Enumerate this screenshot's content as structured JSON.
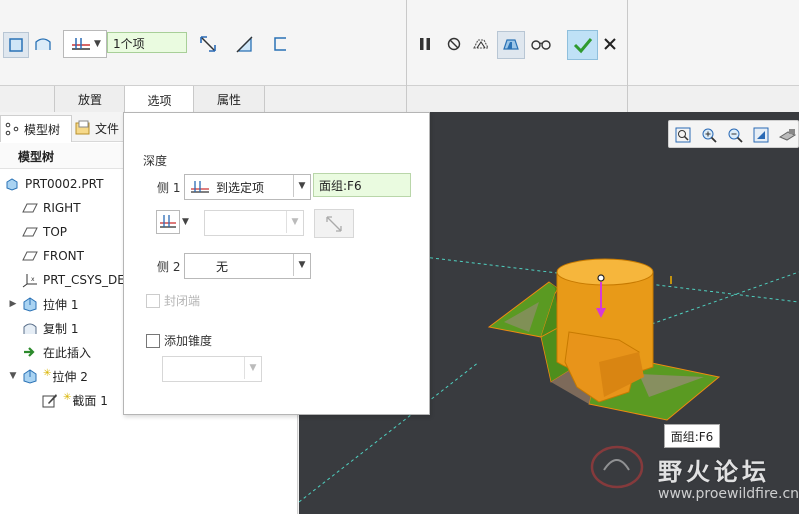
{
  "ribbon": {
    "selection_count": "1个项"
  },
  "tabs": [
    {
      "label": "放置"
    },
    {
      "label": "选项"
    },
    {
      "label": "属性"
    }
  ],
  "left_panel": {
    "tabs": [
      {
        "label": "模型树"
      },
      {
        "label": "文件"
      }
    ],
    "tree_header": "模型树",
    "items": [
      {
        "label": "PRT0002.PRT",
        "icon": "part-icon"
      },
      {
        "label": "RIGHT",
        "icon": "datum-plane-icon"
      },
      {
        "label": "TOP",
        "icon": "datum-plane-icon"
      },
      {
        "label": "FRONT",
        "icon": "datum-plane-icon"
      },
      {
        "label": "PRT_CSYS_DEF",
        "icon": "csys-icon"
      },
      {
        "label": "拉伸 1",
        "icon": "extrude-icon"
      },
      {
        "label": "复制 1",
        "icon": "copy-surface-icon"
      },
      {
        "label": "在此插入",
        "icon": "insert-here-arrow-icon"
      },
      {
        "label": "拉伸 2",
        "icon": "extrude-icon"
      },
      {
        "label": "截面 1",
        "icon": "sketch-icon"
      }
    ]
  },
  "options_panel": {
    "depth_label": "深度",
    "side1_label": "侧 1",
    "side1_value": "到选定项",
    "side1_reference": "面组:F6",
    "side2_label": "侧 2",
    "side2_value": "无",
    "capped_ends_label": "封闭端",
    "add_taper_label": "添加锥度"
  },
  "viewport": {
    "tooltip": "面组:F6",
    "watermark_title": "野火论坛",
    "watermark_url": "www.proewildfire.cn"
  },
  "colors": {
    "viewport_bg": "#393b3f",
    "model_orange": "#f0a020",
    "model_green": "#5a9a22",
    "accent_green": "#3aa63a",
    "field_green_bg": "#eafbe0"
  }
}
